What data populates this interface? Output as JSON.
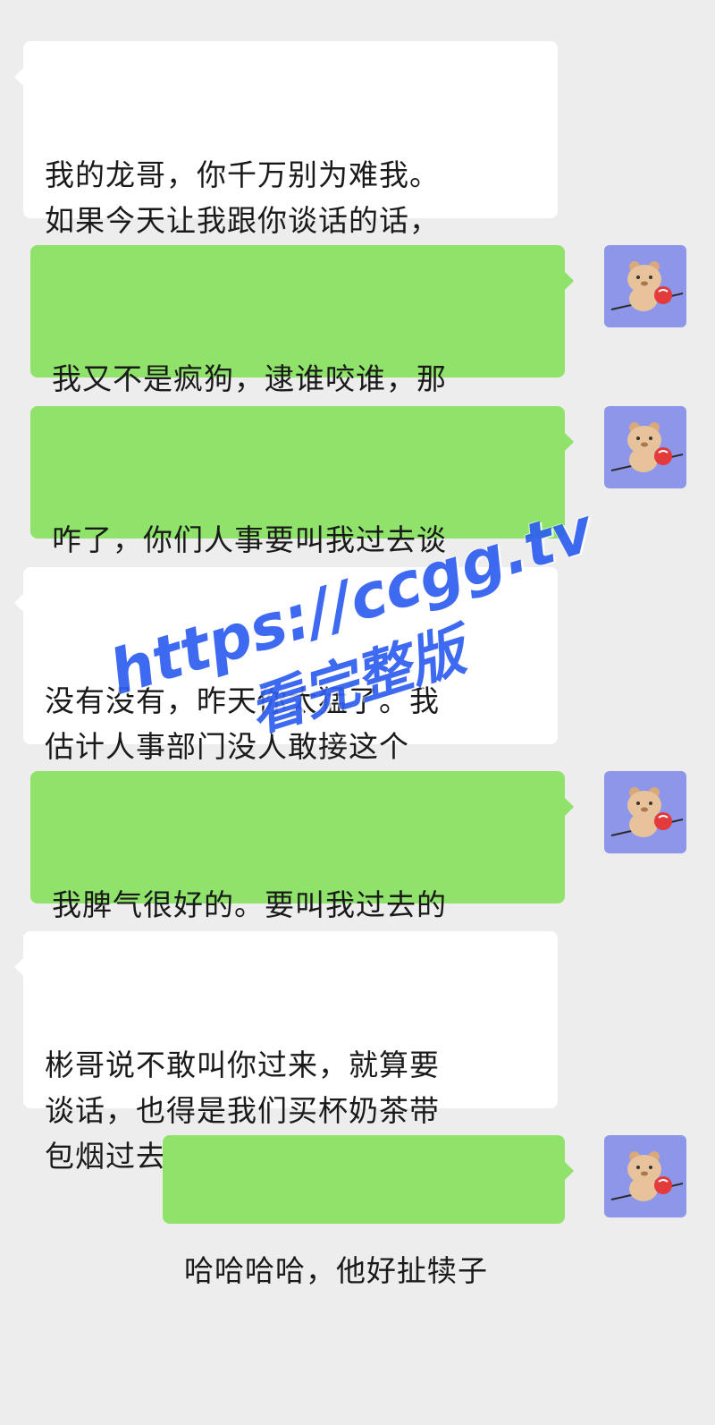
{
  "chat": {
    "messages": [
      {
        "side": "left",
        "text": "我的龙哥，你千万别为难我。\n如果今天让我跟你谈话的话，\n我也只是打工人，我挺你。"
      },
      {
        "side": "right",
        "text": "我又不是疯狗，逮谁咬谁，那\n么多人，我就只骂他们两个",
        "avatar": "bear-avatar"
      },
      {
        "side": "right",
        "text": "咋了，你们人事要叫我过去谈\n话了啊",
        "avatar": "bear-avatar"
      },
      {
        "side": "left",
        "text": "没有没有，昨天你太猛了。我\n估计人事部门没人敢接这个\n活。哈哈哈哈。"
      },
      {
        "side": "right",
        "text": "我脾气很好的。要叫我过去的\n话，说一声",
        "avatar": "bear-avatar"
      },
      {
        "side": "left",
        "text": "彬哥说不敢叫你过来，就算要\n谈话，也得是我们买杯奶茶带\n包烟过去找你"
      },
      {
        "side": "right",
        "text": "哈哈哈哈，他好扯犊子",
        "avatar": "bear-avatar"
      }
    ]
  },
  "watermark": {
    "url": "https://ccgg.tv",
    "tagline": "看完整版"
  },
  "colors": {
    "background": "#ededed",
    "left_bubble": "#ffffff",
    "right_bubble": "#8fe36a",
    "avatar_bg": "#8d96e8",
    "watermark": "#2e5ef0"
  }
}
